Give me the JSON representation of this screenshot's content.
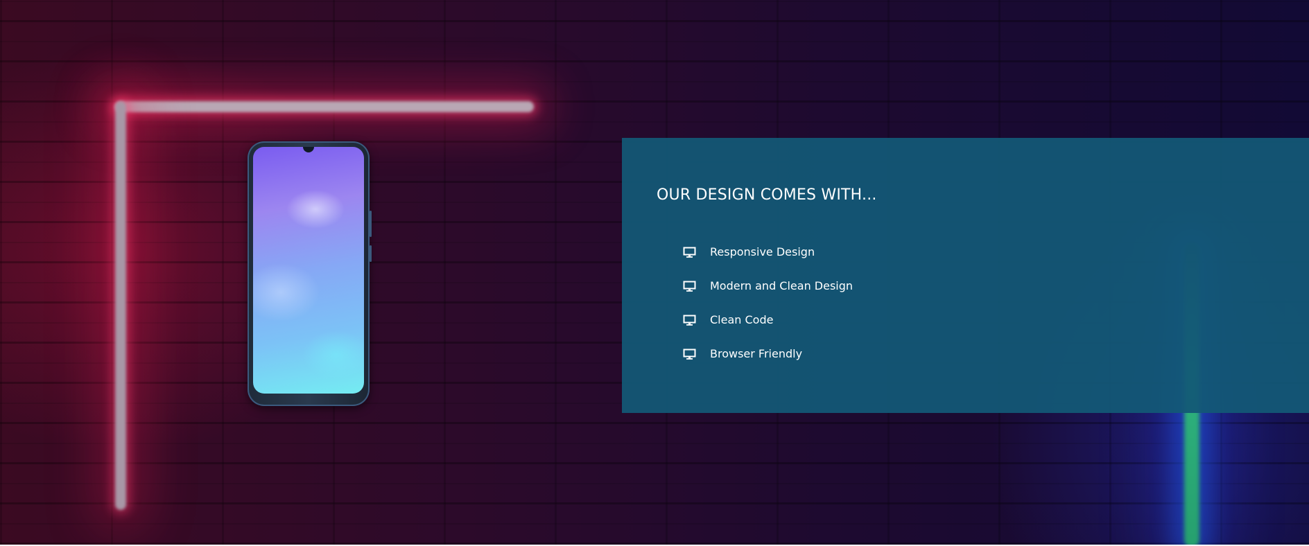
{
  "features_section": {
    "title": "OUR DESIGN COMES WITH...",
    "items": [
      {
        "icon": "monitor-icon",
        "label": "Responsive Design"
      },
      {
        "icon": "monitor-icon",
        "label": "Modern and Clean Design"
      },
      {
        "icon": "monitor-icon",
        "label": "Clean Code"
      },
      {
        "icon": "monitor-icon",
        "label": "Browser Friendly"
      }
    ]
  },
  "colors": {
    "panel_background": "#135876",
    "text": "#ffffff",
    "neon_red": "#e61e50",
    "neon_green": "#2fb37f",
    "neon_blue": "#283cdc"
  }
}
